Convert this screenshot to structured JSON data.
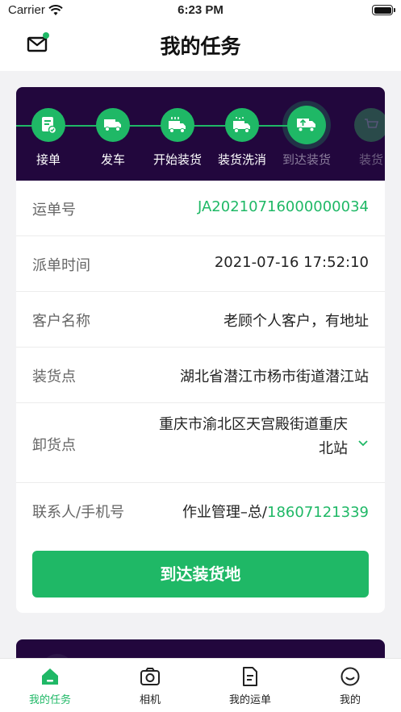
{
  "status_bar": {
    "carrier": "Carrier",
    "time": "6:23 PM"
  },
  "nav": {
    "title": "我的任务"
  },
  "steps": [
    {
      "label": "接单",
      "icon": "order-icon",
      "state": "done"
    },
    {
      "label": "发车",
      "icon": "truck-icon",
      "state": "done"
    },
    {
      "label": "开始装货",
      "icon": "loading-truck-icon",
      "state": "done"
    },
    {
      "label": "装货洗消",
      "icon": "disinfect-truck-icon",
      "state": "done"
    },
    {
      "label": "到达装货",
      "icon": "arrive-truck-icon",
      "state": "current"
    },
    {
      "label": "装货",
      "icon": "cart-icon",
      "state": "future"
    }
  ],
  "fields": {
    "waybill": {
      "label": "运单号",
      "value": "JA20210716000000034"
    },
    "dispatch_time": {
      "label": "派单时间",
      "value": "2021-07-16 17:52:10"
    },
    "customer": {
      "label": "客户名称",
      "value": "老顾个人客户，有地址"
    },
    "loading_point": {
      "label": "装货点",
      "value": "湖北省潜江市杨市街道潜江站"
    },
    "unloading_point": {
      "label": "卸货点",
      "value": "重庆市渝北区天宫殿街道重庆北站"
    },
    "contact": {
      "label": "联系人/手机号",
      "name": "作业管理–总/",
      "phone": "18607121339"
    }
  },
  "action": {
    "label": "到达装货地"
  },
  "tabs": [
    {
      "label": "我的任务",
      "icon": "home-icon",
      "active": true
    },
    {
      "label": "相机",
      "icon": "camera-icon",
      "active": false
    },
    {
      "label": "我的运单",
      "icon": "document-icon",
      "active": false
    },
    {
      "label": "我的",
      "icon": "profile-icon",
      "active": false
    }
  ],
  "colors": {
    "accent": "#1fb866",
    "header_bg": "#22073d",
    "page_bg": "#f2f2f4"
  }
}
